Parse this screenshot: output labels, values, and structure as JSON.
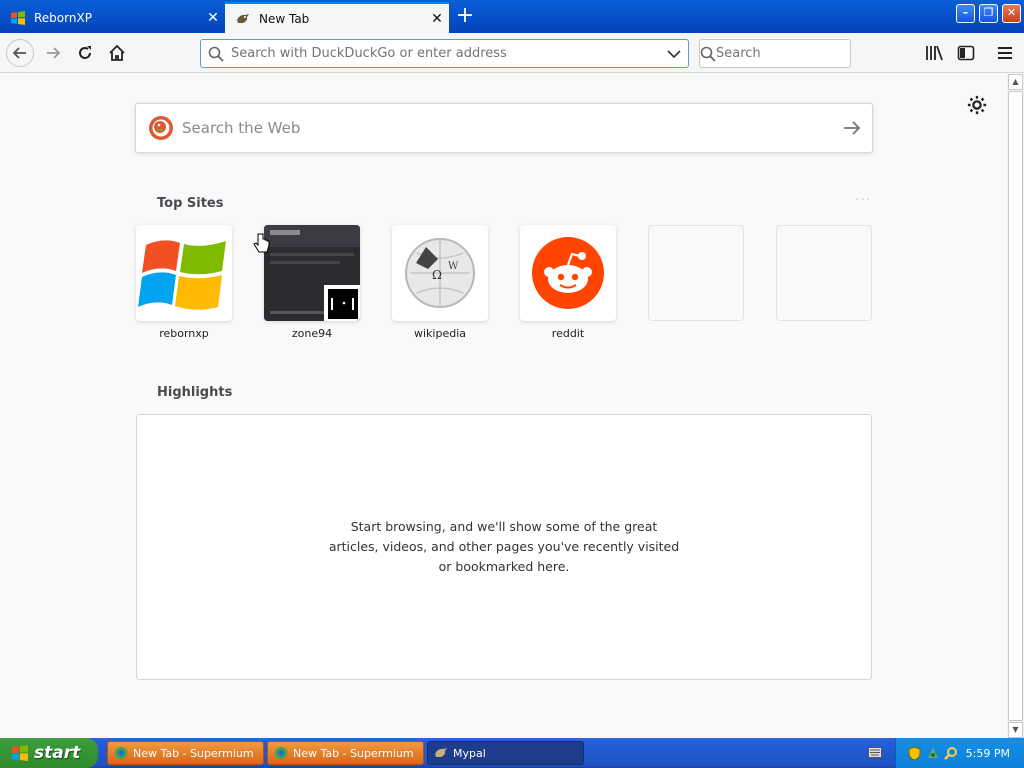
{
  "tabs": [
    {
      "title": "RebornXP",
      "close": "✕"
    },
    {
      "title": "New Tab",
      "close": "✕"
    }
  ],
  "new_tab_glyph": "+",
  "window_buttons": {
    "minimize": "–",
    "restore": "❐",
    "close": "✕"
  },
  "toolbar": {
    "url_placeholder": "Search with DuckDuckGo or enter address",
    "search_placeholder": "Search"
  },
  "newtab": {
    "web_search_placeholder": "Search the Web",
    "top_sites_title": "Top Sites",
    "more_dots": "···",
    "top_sites": [
      {
        "label": "rebornxp",
        "icon": "windows-logo-icon"
      },
      {
        "label": "zone94",
        "icon": "zone94-screenshot"
      },
      {
        "label": "wikipedia",
        "icon": "wikipedia-globe-icon"
      },
      {
        "label": "reddit",
        "icon": "reddit-snoo-icon"
      },
      {
        "label": "",
        "icon": ""
      },
      {
        "label": "",
        "icon": ""
      }
    ],
    "highlights_title": "Highlights",
    "highlights_empty": "Start browsing, and we'll show some of the great articles, videos, and other pages you've recently visited or bookmarked here."
  },
  "taskbar": {
    "start_label": "start",
    "tasks": [
      {
        "label": "New Tab - Supermium"
      },
      {
        "label": "New Tab - Supermium"
      },
      {
        "label": "Mypal"
      }
    ],
    "clock": "5:59 PM"
  },
  "colors": {
    "accent": "#0a84ff",
    "reddit": "#ff4500",
    "taskbar": "#245edb",
    "start": "#3c9e3c"
  }
}
